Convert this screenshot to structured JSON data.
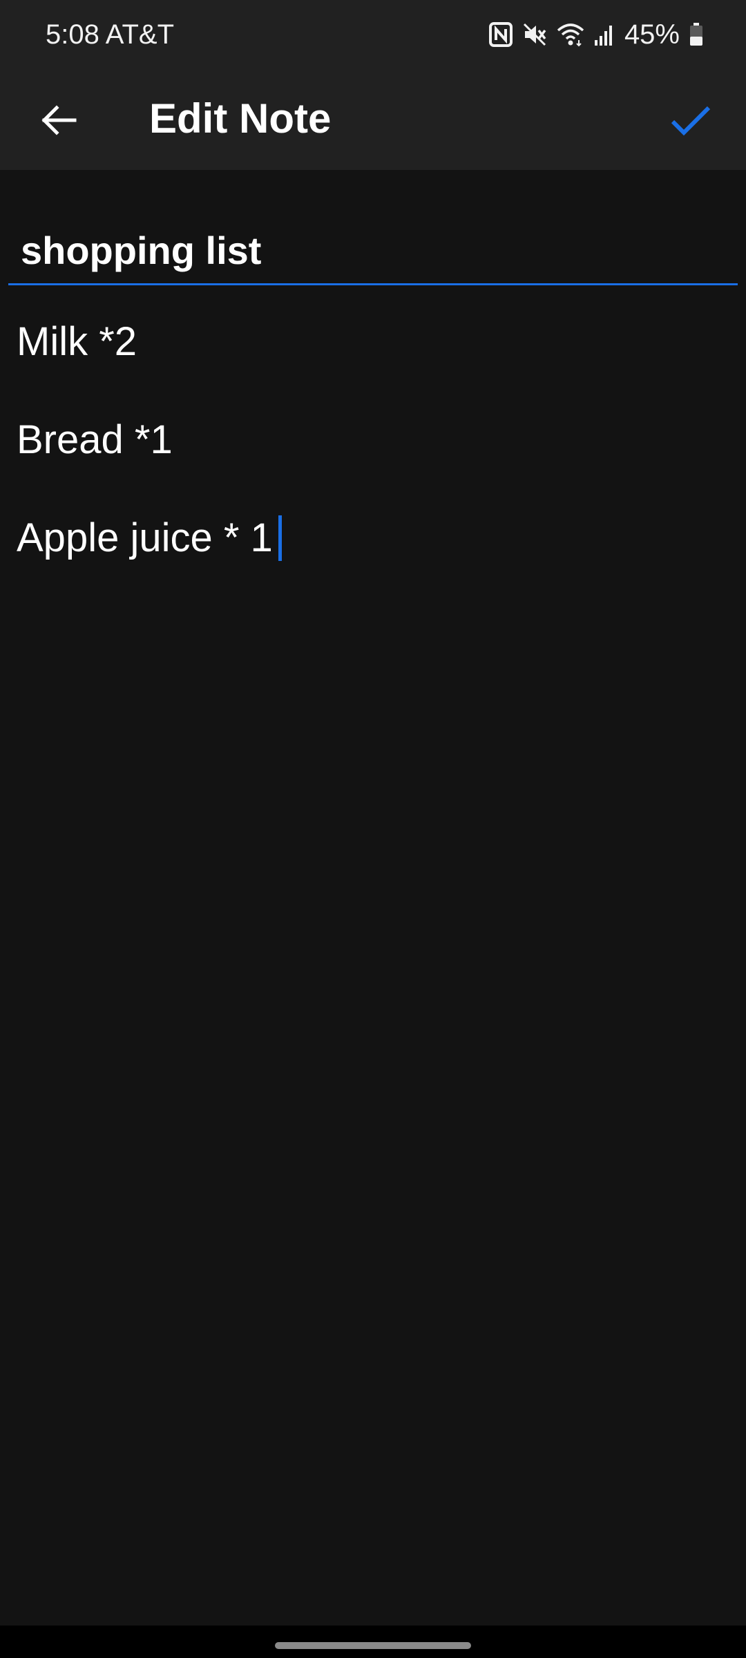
{
  "status_bar": {
    "time": "5:08 AT&T",
    "battery_percent": "45%",
    "battery_level": 0.45,
    "icons": [
      "nfc-icon",
      "mute-icon",
      "wifi-icon",
      "signal-icon",
      "battery-icon"
    ]
  },
  "app_bar": {
    "title": "Edit Note",
    "back_icon": "arrow-left-icon",
    "save_icon": "check-icon"
  },
  "note": {
    "title": "shopping list",
    "lines": [
      "Milk *2",
      "Bread *1",
      "Apple juice * 1"
    ]
  },
  "colors": {
    "accent": "#1a6fe6",
    "background": "#131313",
    "bar": "#212121"
  }
}
